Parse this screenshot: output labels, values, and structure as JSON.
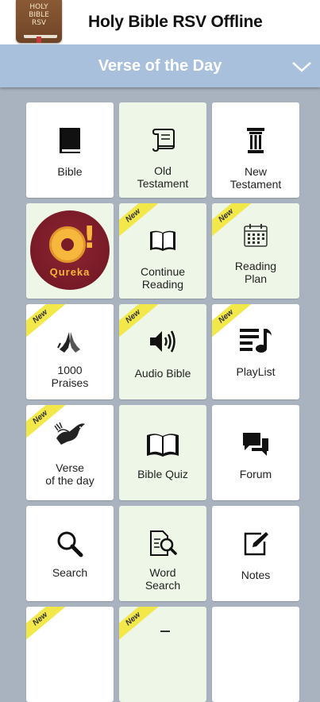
{
  "header": {
    "app_icon_text": "HOLY\nBIBLE\nRSV",
    "title": "Holy Bible RSV Offline"
  },
  "votd_bar": {
    "label": "Verse of the Day"
  },
  "badge_text": "New",
  "tiles": [
    {
      "label": "Bible",
      "icon": "book-icon",
      "new": false
    },
    {
      "label": "Old\nTestament",
      "icon": "scroll-icon",
      "new": false
    },
    {
      "label": "New\nTestament",
      "icon": "pillar-icon",
      "new": false
    },
    {
      "label": "",
      "icon": "qureka-logo",
      "brand_text": "Qureka",
      "new": false
    },
    {
      "label": "Continue\nReading",
      "icon": "open-book-icon",
      "new": true
    },
    {
      "label": "Reading\nPlan",
      "icon": "calendar-icon",
      "new": true
    },
    {
      "label": "1000\nPraises",
      "icon": "praying-hands-icon",
      "new": true
    },
    {
      "label": "Audio Bible",
      "icon": "speaker-icon",
      "new": true
    },
    {
      "label": "PlayList",
      "icon": "playlist-icon",
      "new": true
    },
    {
      "label": "Verse\nof the day",
      "icon": "dove-icon",
      "new": true
    },
    {
      "label": "Bible Quiz",
      "icon": "open-bible-icon",
      "new": false
    },
    {
      "label": "Forum",
      "icon": "chat-bubbles-icon",
      "new": false
    },
    {
      "label": "Search",
      "icon": "magnifier-icon",
      "new": false
    },
    {
      "label": "Word\nSearch",
      "icon": "document-search-icon",
      "new": false
    },
    {
      "label": "Notes",
      "icon": "edit-note-icon",
      "new": false
    }
  ],
  "partial_row_badges": [
    "New",
    "New"
  ]
}
